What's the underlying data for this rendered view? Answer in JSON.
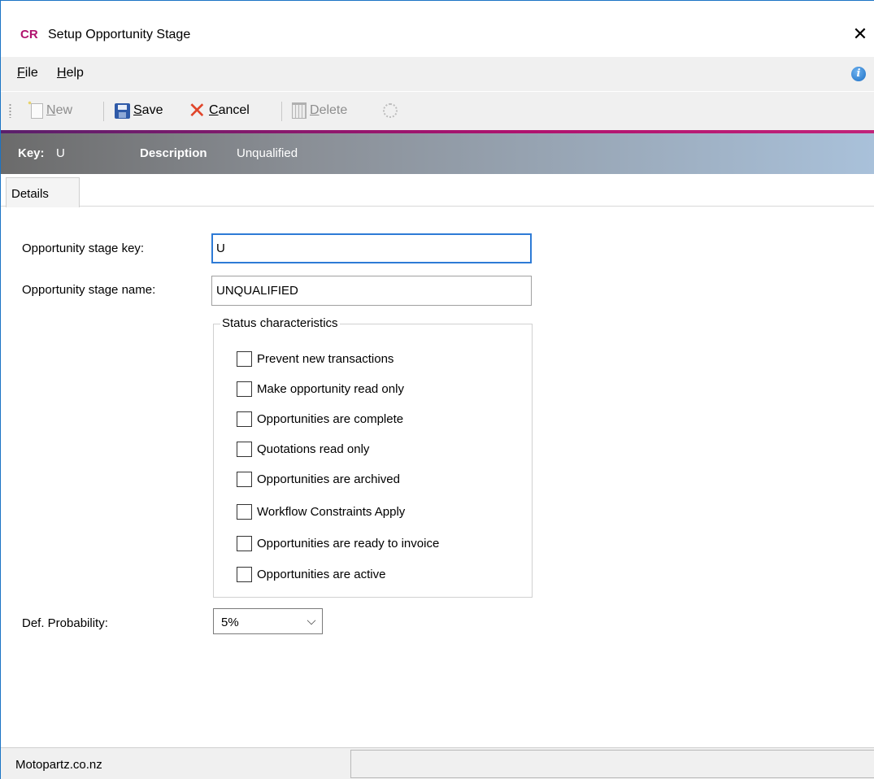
{
  "titlebar": {
    "app_logo": "CR",
    "title": "Setup Opportunity Stage",
    "close_symbol": "✕"
  },
  "menu": {
    "items": [
      {
        "accel": "F",
        "rest": "ile"
      },
      {
        "accel": "H",
        "rest": "elp"
      }
    ],
    "info_icon": "info-icon",
    "info_symbol": "i"
  },
  "toolbar": {
    "new": {
      "accel": "N",
      "rest": "ew",
      "enabled": false
    },
    "save": {
      "accel": "S",
      "rest": "ave",
      "enabled": true
    },
    "cancel": {
      "accel": "C",
      "rest": "ancel",
      "enabled": true,
      "symbol": "✕"
    },
    "delete": {
      "accel": "D",
      "rest": "elete",
      "enabled": false
    }
  },
  "key_header": {
    "key_label": "Key:",
    "key_value": "U",
    "description_label": "Description",
    "description_value": "Unqualified"
  },
  "tabs": [
    {
      "label": "Details",
      "active": true
    }
  ],
  "form": {
    "stage_key_label": "Opportunity stage key:",
    "stage_key_value": "U",
    "stage_name_label": "Opportunity stage name:",
    "stage_name_value": "UNQUALIFIED",
    "status_group_title": "Status characteristics",
    "checkboxes": [
      {
        "label": "Prevent new transactions",
        "checked": false
      },
      {
        "label": "Make opportunity read only",
        "checked": false
      },
      {
        "label": "Opportunities are complete",
        "checked": false
      },
      {
        "label": "Quotations read only",
        "checked": false
      },
      {
        "label": "Opportunities are archived",
        "checked": false
      },
      {
        "label": "Workflow Constraints Apply",
        "checked": false
      },
      {
        "label": "Opportunities are ready to invoice",
        "checked": false
      },
      {
        "label": "Opportunities are active",
        "checked": false
      }
    ],
    "probability_label": "Def. Probability:",
    "probability_value": "5%"
  },
  "statusbar": {
    "left_text": "Motopartz.co.nz",
    "right_text": ""
  },
  "colors": {
    "accent": "#b0126e",
    "focus_border": "#2e7bd6",
    "cancel_red": "#e0452a",
    "save_blue": "#2f5aa8"
  }
}
